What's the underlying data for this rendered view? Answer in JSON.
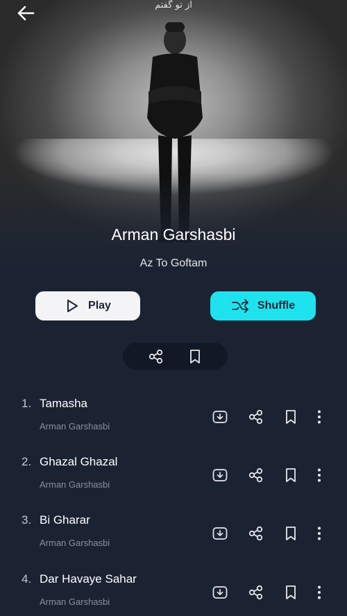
{
  "header": {
    "back_icon": "arrow-left-icon",
    "logo_text": "از تو گفتم"
  },
  "album": {
    "artist": "Arman Garshasbi",
    "title": "Az To Goftam"
  },
  "actions": {
    "play_label": "Play",
    "shuffle_label": "Shuffle",
    "shuffle_color": "#1ee3ee"
  },
  "share_bar": {
    "icons": [
      "share-icon",
      "bookmark-icon"
    ]
  },
  "tracks": [
    {
      "number": "1.",
      "title": "Tamasha",
      "artist": "Arman Garshasbi"
    },
    {
      "number": "2.",
      "title": "Ghazal Ghazal",
      "artist": "Arman Garshasbi"
    },
    {
      "number": "3.",
      "title": "Bi Gharar",
      "artist": "Arman Garshasbi"
    },
    {
      "number": "4.",
      "title": "Dar Havaye Sahar",
      "artist": "Arman Garshasbi"
    }
  ]
}
